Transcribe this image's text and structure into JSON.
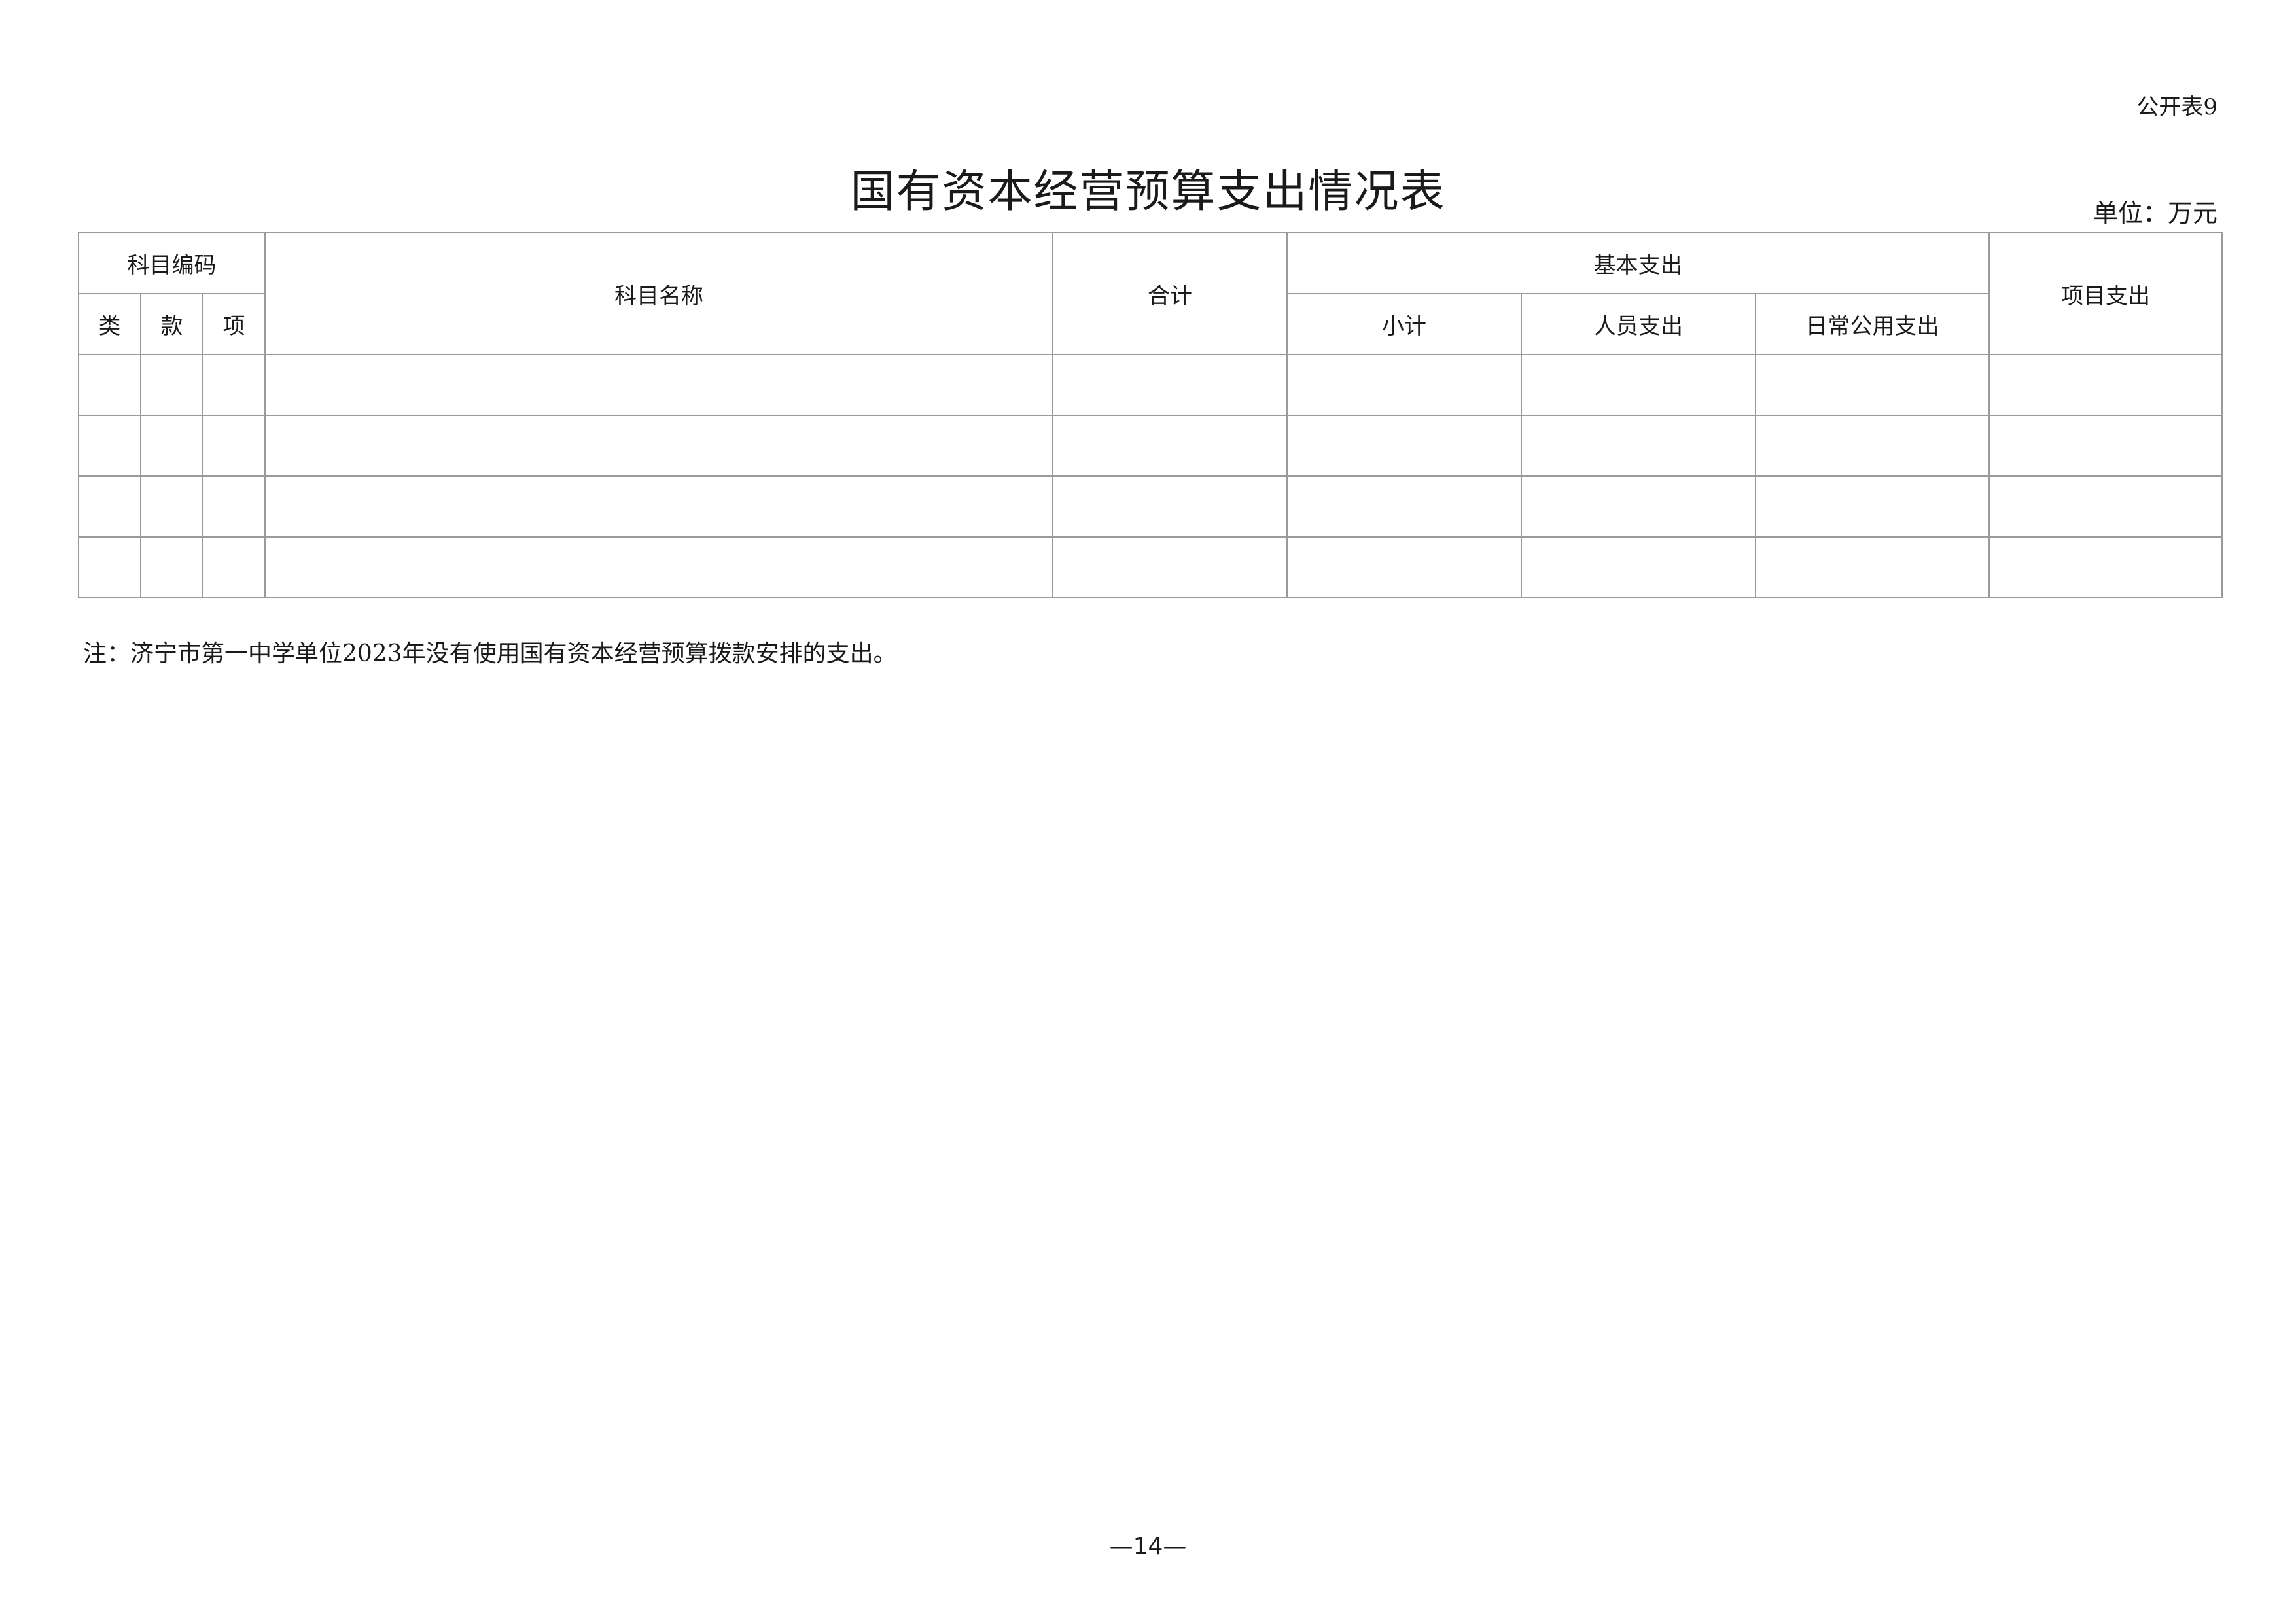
{
  "form_number": "公开表9",
  "title": "国有资本经营预算支出情况表",
  "unit": "单位：万元",
  "table": {
    "headers": {
      "subject_code": "科目编码",
      "category": "类",
      "section": "款",
      "item": "项",
      "subject_name": "科目名称",
      "total": "合计",
      "basic_expenditure": "基本支出",
      "subtotal": "小计",
      "personnel_expenditure": "人员支出",
      "daily_public_expenditure": "日常公用支出",
      "project_expenditure": "项目支出"
    },
    "rows": [
      [
        "",
        "",
        "",
        "",
        "",
        "",
        "",
        "",
        ""
      ],
      [
        "",
        "",
        "",
        "",
        "",
        "",
        "",
        "",
        ""
      ],
      [
        "",
        "",
        "",
        "",
        "",
        "",
        "",
        "",
        ""
      ],
      [
        "",
        "",
        "",
        "",
        "",
        "",
        "",
        "",
        ""
      ]
    ]
  },
  "note": "注：济宁市第一中学单位2023年没有使用国有资本经营预算拨款安排的支出。",
  "page_number": "—14—"
}
